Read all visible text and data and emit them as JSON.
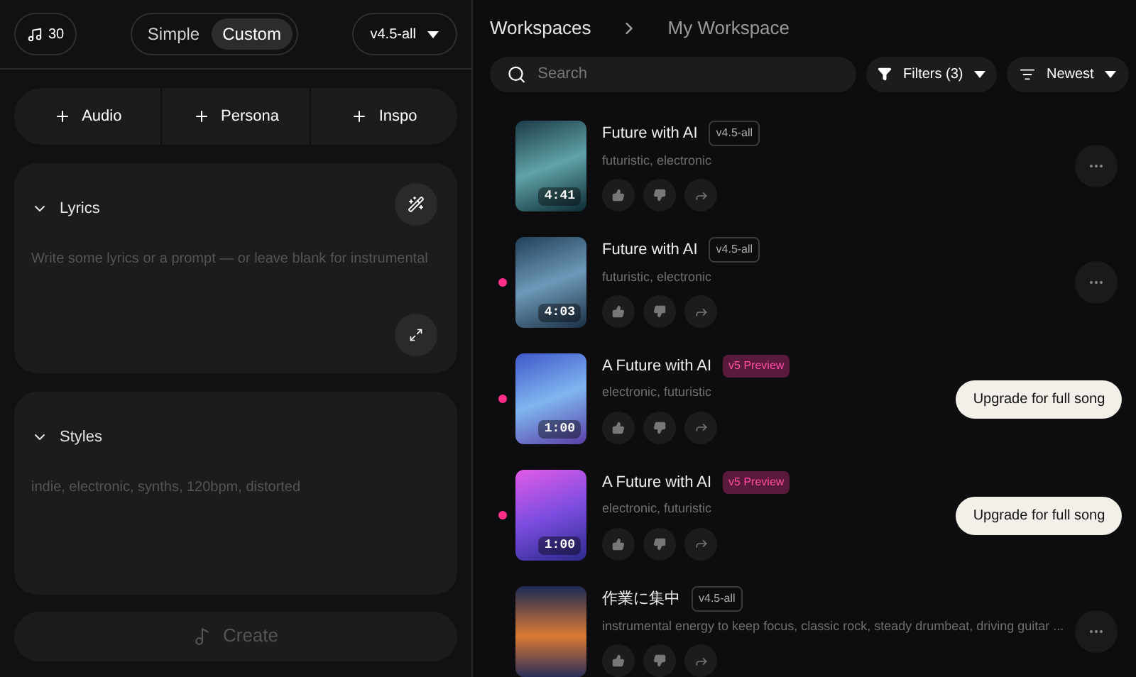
{
  "credits": {
    "count": "30"
  },
  "mode_toggle": [
    {
      "label": "Simple",
      "selected": false
    },
    {
      "label": "Custom",
      "selected": true
    }
  ],
  "model_select": {
    "value": "v4.5-all"
  },
  "add_buttons": [
    "Audio",
    "Persona",
    "Inspo"
  ],
  "lyrics": {
    "title": "Lyrics",
    "expanded": true,
    "placeholder": "Write some lyrics or a prompt — or leave blank for instrumental"
  },
  "styles": {
    "title": "Styles",
    "expanded": true,
    "placeholder": "indie, electronic, synths, 120bpm, distorted"
  },
  "create_button": {
    "label": "Create",
    "disabled": true
  },
  "breadcrumb": [
    "Workspaces",
    "My Workspace"
  ],
  "search": {
    "placeholder": "Search"
  },
  "filters": {
    "label": "Filters (3)"
  },
  "sort": {
    "label": "Newest"
  },
  "songs": [
    {
      "title": "Future with AI",
      "badge": {
        "text": "v4.5-all",
        "kind": "model"
      },
      "tags": "futuristic, electronic",
      "duration": "4:41",
      "unread": false,
      "action": {
        "kind": "more"
      }
    },
    {
      "title": "Future with AI",
      "badge": {
        "text": "v4.5-all",
        "kind": "model"
      },
      "tags": "futuristic, electronic",
      "duration": "4:03",
      "unread": true,
      "action": {
        "kind": "more"
      }
    },
    {
      "title": "A Future with AI",
      "badge": {
        "text": "v5 Preview",
        "kind": "preview"
      },
      "tags": "electronic, futuristic",
      "duration": "1:00",
      "unread": true,
      "action": {
        "kind": "upgrade",
        "label": "Upgrade for full song"
      }
    },
    {
      "title": "A Future with AI",
      "badge": {
        "text": "v5 Preview",
        "kind": "preview"
      },
      "tags": "electronic, futuristic",
      "duration": "1:00",
      "unread": true,
      "action": {
        "kind": "upgrade",
        "label": "Upgrade for full song"
      }
    },
    {
      "title": "作業に集中",
      "badge": {
        "text": "v4.5-all",
        "kind": "model"
      },
      "tags": "instrumental energy to keep focus, classic rock, steady drumbeat, driving guitar ...",
      "unread": false,
      "action": {
        "kind": "more"
      }
    }
  ]
}
